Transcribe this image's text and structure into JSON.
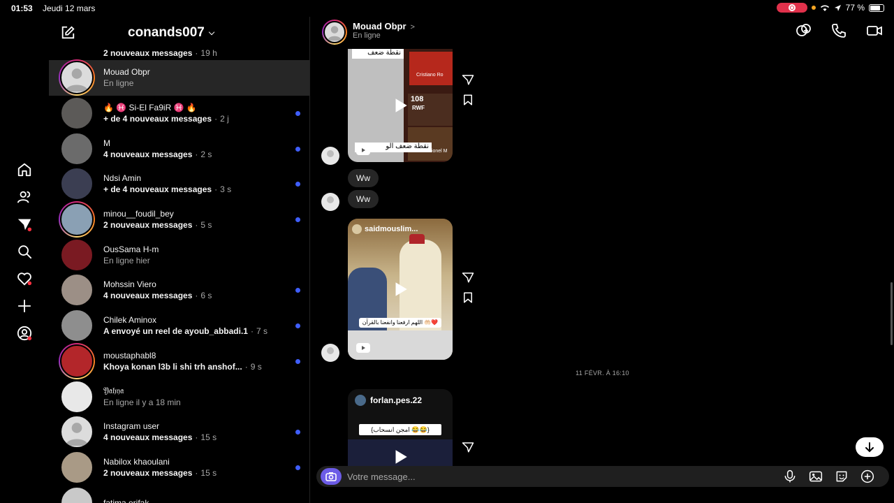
{
  "status_bar": {
    "time": "01:53",
    "date": "Jeudi 12 mars",
    "battery": "77 %",
    "battery_level": 0.77
  },
  "rail": {
    "items": [
      {
        "name": "home-icon"
      },
      {
        "name": "people-icon"
      },
      {
        "name": "messages-icon"
      },
      {
        "name": "search-icon"
      },
      {
        "name": "heart-icon"
      },
      {
        "name": "plus-icon"
      },
      {
        "name": "profile-icon"
      }
    ]
  },
  "list": {
    "account": "conands007",
    "partial_top": {
      "sub": "2 nouveaux messages",
      "time": "19 h"
    },
    "conversations": [
      {
        "name": "Mouad Obpr",
        "sub": "En ligne",
        "time": "",
        "bold": false,
        "unread": false,
        "ring": true,
        "active": true,
        "avatar": "default"
      },
      {
        "name": "🔥 ♓ Si-El Fa9iR ♓ 🔥",
        "sub": "+ de 4 nouveaux messages",
        "time": "2 j",
        "bold": true,
        "unread": true,
        "ring": false,
        "active": false,
        "avatar": "#5c5a58"
      },
      {
        "name": "M",
        "sub": "4 nouveaux messages",
        "time": "2 s",
        "bold": true,
        "unread": true,
        "ring": false,
        "active": false,
        "avatar": "#6b6b6b"
      },
      {
        "name": "Ndsi Amin",
        "sub": "+ de 4 nouveaux messages",
        "time": "3 s",
        "bold": true,
        "unread": true,
        "ring": false,
        "active": false,
        "avatar": "#3b3e52"
      },
      {
        "name": "minou__foudil_bey",
        "sub": "2 nouveaux messages",
        "time": "5 s",
        "bold": true,
        "unread": true,
        "ring": true,
        "active": false,
        "avatar": "#8aa0b4"
      },
      {
        "name": "OusSama H-m",
        "sub": "En ligne hier",
        "time": "",
        "bold": false,
        "unread": false,
        "ring": false,
        "active": false,
        "avatar": "#7a1a22"
      },
      {
        "name": "Mohssin Viero",
        "sub": "4 nouveaux messages",
        "time": "6 s",
        "bold": true,
        "unread": true,
        "ring": false,
        "active": false,
        "avatar": "#9c8f86"
      },
      {
        "name": "Chilek Aminox",
        "sub": "A envoyé un reel de ayoub_abbadi.1",
        "time": "7 s",
        "bold": true,
        "unread": true,
        "ring": false,
        "active": false,
        "avatar": "#8e8e8e"
      },
      {
        "name": "moustaphabl8",
        "sub": "Khoya konan l3b li shi trh anshof...",
        "time": "9 s",
        "bold": true,
        "unread": true,
        "ring": true,
        "active": false,
        "avatar": "#b3262a"
      },
      {
        "name": "𝔜𝔞𝔥𝔶𝔞",
        "sub": "En ligne il y a 18 min",
        "time": "",
        "bold": false,
        "unread": false,
        "ring": false,
        "active": false,
        "avatar": "#e8e8e8"
      },
      {
        "name": "Instagram user",
        "sub": "4 nouveaux messages",
        "time": "15 s",
        "bold": true,
        "unread": true,
        "ring": false,
        "active": false,
        "avatar": "default"
      },
      {
        "name": "Nabilox khaoulani",
        "sub": "2 nouveaux messages",
        "time": "15 s",
        "bold": true,
        "unread": true,
        "ring": false,
        "active": false,
        "avatar": "#a99a86"
      },
      {
        "name": "fatima erifak",
        "sub": "",
        "time": "",
        "bold": false,
        "unread": false,
        "ring": false,
        "active": false,
        "avatar": "#c9c9c9"
      }
    ]
  },
  "chat": {
    "name": "Mouad Obpr",
    "status": "En ligne",
    "messages": {
      "reel1": {
        "top_text": "نقطة ضعف",
        "bottom_text": "نقطة ضعف الو",
        "label_a": "Cristiano Ro",
        "label_b": "108",
        "label_c": "RWF",
        "label_d": "Lionel M"
      },
      "bubble1": "Ww",
      "bubble2": "Ww",
      "reel2": {
        "author": "saidmouslim...",
        "caption": "اللهم ارفعنا وانفعنا بالقرآن 🤲🏻❤️"
      },
      "date_divider": "11 FÉVR. À 16:10",
      "reel3": {
        "author": "forlan.pes.22",
        "caption": "{امجن انسحاب 😂😂}"
      }
    },
    "composer": {
      "placeholder": "Votre message..."
    }
  }
}
